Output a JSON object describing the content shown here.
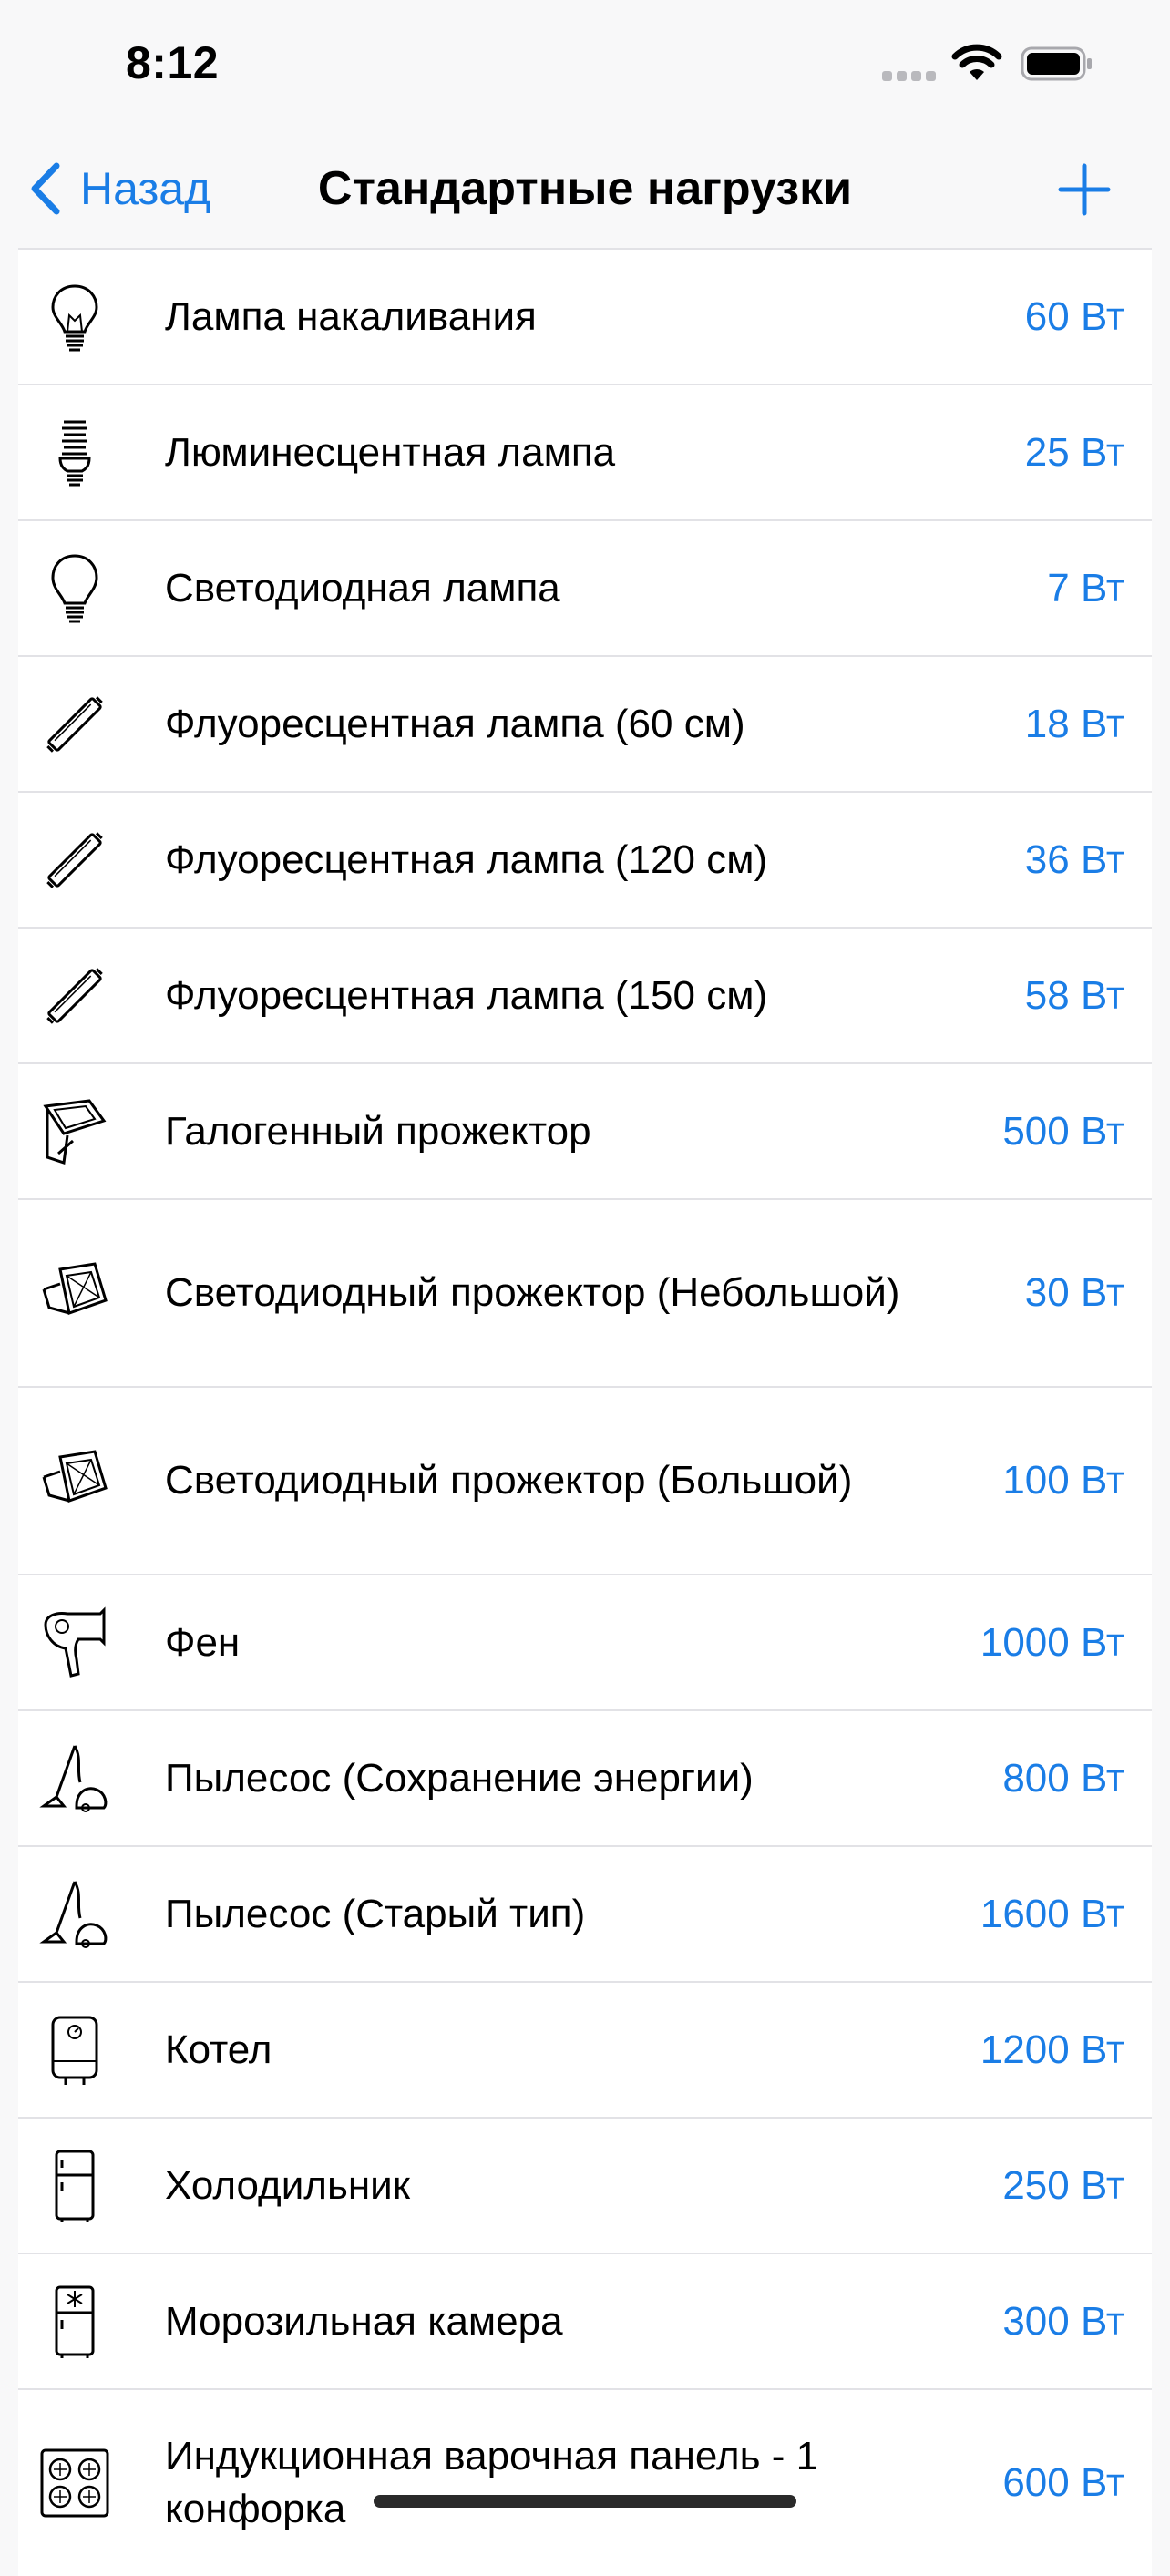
{
  "status_bar": {
    "time": "8:12"
  },
  "nav": {
    "back_label": "Назад",
    "title": "Стандартные нагрузки",
    "accent_color": "#1a7de6"
  },
  "items": [
    {
      "icon": "incandescent-bulb-icon",
      "name": "Лампа накаливания",
      "power": "60 Вт"
    },
    {
      "icon": "cfl-bulb-icon",
      "name": "Люминесцентная лампа",
      "power": "25 Вт"
    },
    {
      "icon": "led-bulb-icon",
      "name": "Светодиодная лампа",
      "power": "7 Вт"
    },
    {
      "icon": "fluorescent-tube-icon",
      "name": "Флуоресцентная лампа (60 см)",
      "power": "18 Вт"
    },
    {
      "icon": "fluorescent-tube-icon",
      "name": "Флуоресцентная лампа (120 см)",
      "power": "36 Вт"
    },
    {
      "icon": "fluorescent-tube-icon",
      "name": "Флуоресцентная лампа (150 см)",
      "power": "58 Вт"
    },
    {
      "icon": "halogen-floodlight-icon",
      "name": "Галогенный прожектор",
      "power": "500 Вт"
    },
    {
      "icon": "led-floodlight-icon",
      "name": "Светодиодный прожектор (Небольшой)",
      "power": "30 Вт"
    },
    {
      "icon": "led-floodlight-icon",
      "name": "Светодиодный прожектор (Большой)",
      "power": "100 Вт"
    },
    {
      "icon": "hair-dryer-icon",
      "name": "Фен",
      "power": "1000 Вт"
    },
    {
      "icon": "vacuum-cleaner-icon",
      "name": "Пылесос (Сохранение энергии)",
      "power": "800 Вт"
    },
    {
      "icon": "vacuum-cleaner-icon",
      "name": "Пылесос (Старый тип)",
      "power": "1600 Вт"
    },
    {
      "icon": "water-heater-icon",
      "name": "Котел",
      "power": "1200 Вт"
    },
    {
      "icon": "refrigerator-icon",
      "name": "Холодильник",
      "power": "250 Вт"
    },
    {
      "icon": "freezer-icon",
      "name": "Морозильная камера",
      "power": "300 Вт"
    },
    {
      "icon": "induction-cooktop-icon",
      "name": "Индукционная варочная панель - 1 конфорка",
      "power": "600 Вт"
    }
  ]
}
